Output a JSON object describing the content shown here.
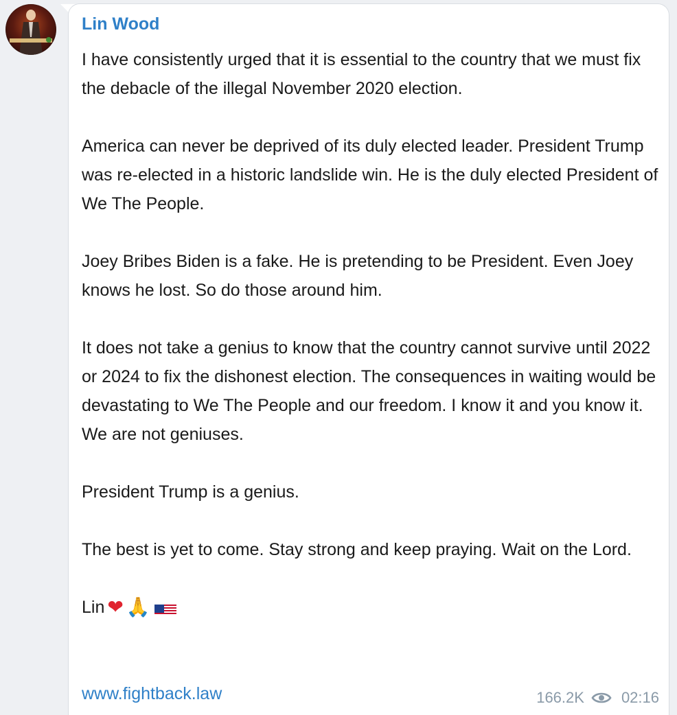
{
  "post": {
    "sender": "Lin Wood",
    "paragraphs": [
      "I have consistently urged that it is essential to the country that we must fix the debacle of the illegal November 2020 election.",
      "America can never be deprived of its duly elected leader. President Trump was re-elected in a historic landslide win. He is the duly elected President of We The People.",
      "Joey Bribes Biden is a fake. He is pretending to be President. Even Joey knows he lost. So do those around him.",
      "It does not take a genius to know that the country cannot survive until 2022 or 2024 to fix the dishonest election. The consequences in waiting would be devastating to We The People and our freedom. I know it and you know it. We are not geniuses.",
      "President Trump is a genius.",
      "The best is yet to come. Stay strong and keep praying. Wait on the Lord."
    ],
    "signature": "Lin",
    "signature_emojis": {
      "heart": "❤",
      "pray": "🙏",
      "flag": "us-flag-emoji"
    },
    "link": "www.fightback.law",
    "views": "166.2K",
    "time": "02:16",
    "view_icon": "eye-icon"
  },
  "colors": {
    "accent": "#2f80c8",
    "meta": "#8a9aa8",
    "background": "#eef0f3"
  }
}
